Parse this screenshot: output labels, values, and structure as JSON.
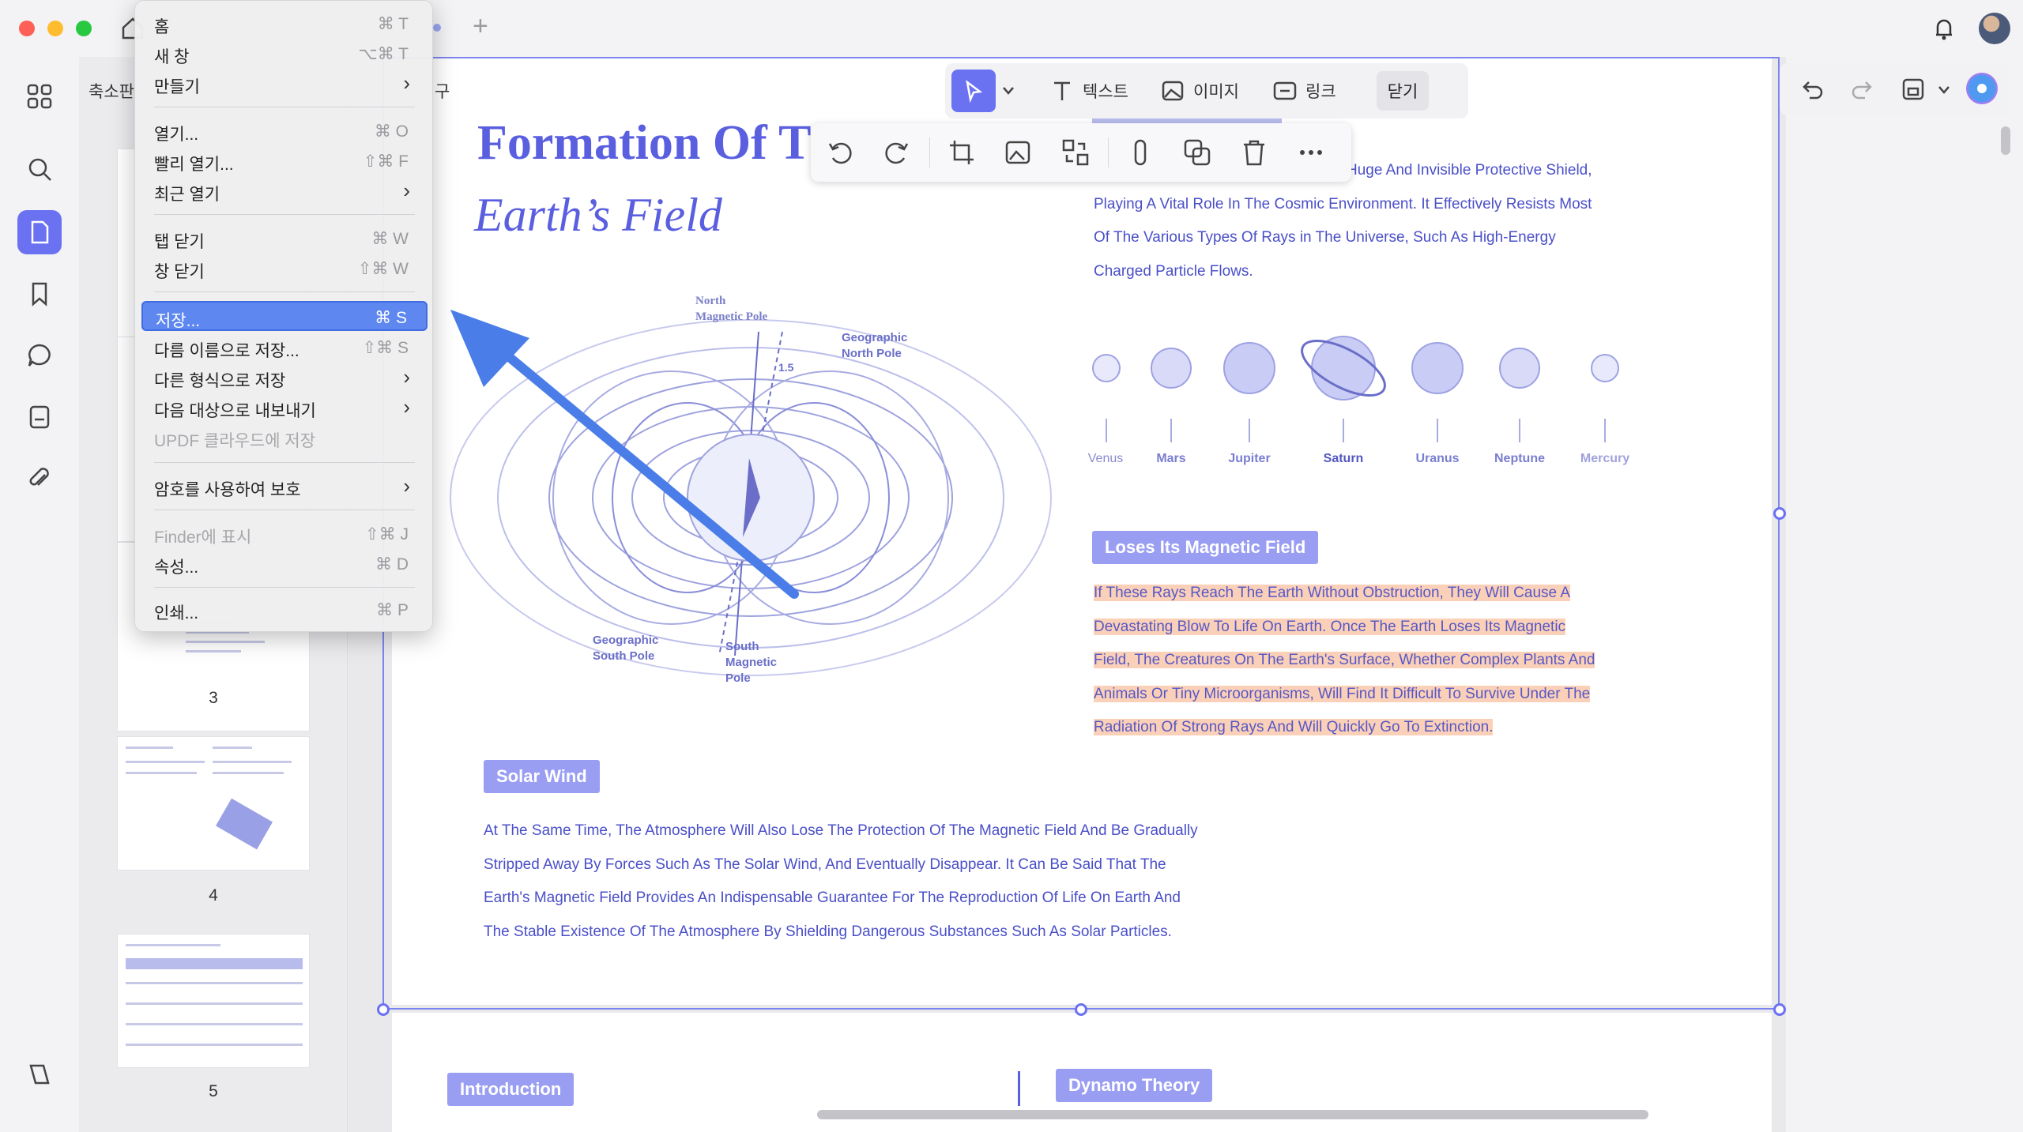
{
  "thumbnails": {
    "title": "축소판",
    "pages": [
      "3",
      "4",
      "5"
    ]
  },
  "toolbar": {
    "text_label": "텍스트",
    "image_label": "이미지",
    "link_label": "링크",
    "close_label": "닫기"
  },
  "menu": {
    "items": [
      {
        "label": "홈",
        "shortcut": "⌘ T"
      },
      {
        "label": "새 창",
        "shortcut": "⌥⌘ T"
      },
      {
        "label": "만들기",
        "submenu": "›"
      },
      {
        "label": "열기...",
        "shortcut": "⌘ O"
      },
      {
        "label": "빨리 열기...",
        "shortcut": "⇧⌘ F"
      },
      {
        "label": "최근 열기",
        "submenu": "›"
      },
      {
        "label": "탭 닫기",
        "shortcut": "⌘ W"
      },
      {
        "label": "창 닫기",
        "shortcut": "⇧⌘ W"
      },
      {
        "label": "저장...",
        "shortcut": "⌘ S"
      },
      {
        "label": "다름 이름으로 저장...",
        "shortcut": "⇧⌘ S"
      },
      {
        "label": "다른 형식으로 저장",
        "submenu": "›"
      },
      {
        "label": "다음 대상으로 내보내기",
        "submenu": "›"
      },
      {
        "label": "UPDF 클라우드에 저장"
      },
      {
        "label": "암호를 사용하여 보호",
        "submenu": "›"
      },
      {
        "label": "Finder에 표시",
        "shortcut": "⇧⌘ J"
      },
      {
        "label": "속성...",
        "shortcut": "⌘ D"
      },
      {
        "label": "인쇄...",
        "shortcut": "⌘ P"
      }
    ],
    "hidden_tab_fragment": "구"
  },
  "doc": {
    "title": "Formation Of T",
    "subtitle": "Earth’s  Field",
    "diagram": {
      "north_magnetic_pole": [
        "North",
        "Magnetic Pole"
      ],
      "geographic_north": [
        "Geographic",
        "North Pole"
      ],
      "angle": "1.5",
      "geographic_south": [
        "Geographic",
        "South Pole"
      ],
      "south_magnetic": [
        "South",
        "Magnetic",
        "Pole"
      ]
    },
    "intro_lines": [
      "Huge And Invisible Protective Shield,",
      "Playing A Vital Role In The Cosmic Environment. It Effectively Resists Most",
      "Of The Various Types Of Rays in The Universe, Such As High-Energy",
      "Charged Particle Flows."
    ],
    "planets": [
      "Venus",
      "Mars",
      "Jupiter",
      "Saturn",
      "Uranus",
      "Neptune",
      "Mercury"
    ],
    "loses_tag": "Loses Its Magnetic Field",
    "loses_lines": [
      "If These Rays Reach The Earth Without Obstruction, They Will Cause A",
      "Devastating Blow To Life On Earth. Once The Earth Loses Its Magnetic",
      "Field, The Creatures On The Earth's Surface, Whether Complex Plants And",
      "Animals Or Tiny Microorganisms, Will Find It Difficult To Survive Under The",
      "Radiation Of Strong Rays And Will Quickly Go To Extinction."
    ],
    "solar_tag": "Solar Wind",
    "solar_lines": [
      "At The Same Time, The Atmosphere Will Also Lose The Protection Of The Magnetic Field And Be Gradually",
      "Stripped Away By Forces Such As The Solar Wind, And Eventually Disappear. It Can Be Said That The",
      "Earth's Magnetic Field Provides An Indispensable Guarantee For The Reproduction Of Life On Earth And",
      "The Stable Existence Of The Atmosphere By Shielding Dangerous Substances Such As Solar Particles."
    ],
    "intro_tag": "Introduction",
    "dynamo_tag": "Dynamo Theory"
  },
  "colors": {
    "accent": "#6a72f2",
    "doc_text": "#4a4fc8",
    "highlight": "#fbd0b8",
    "arrow": "#4a7de8"
  }
}
